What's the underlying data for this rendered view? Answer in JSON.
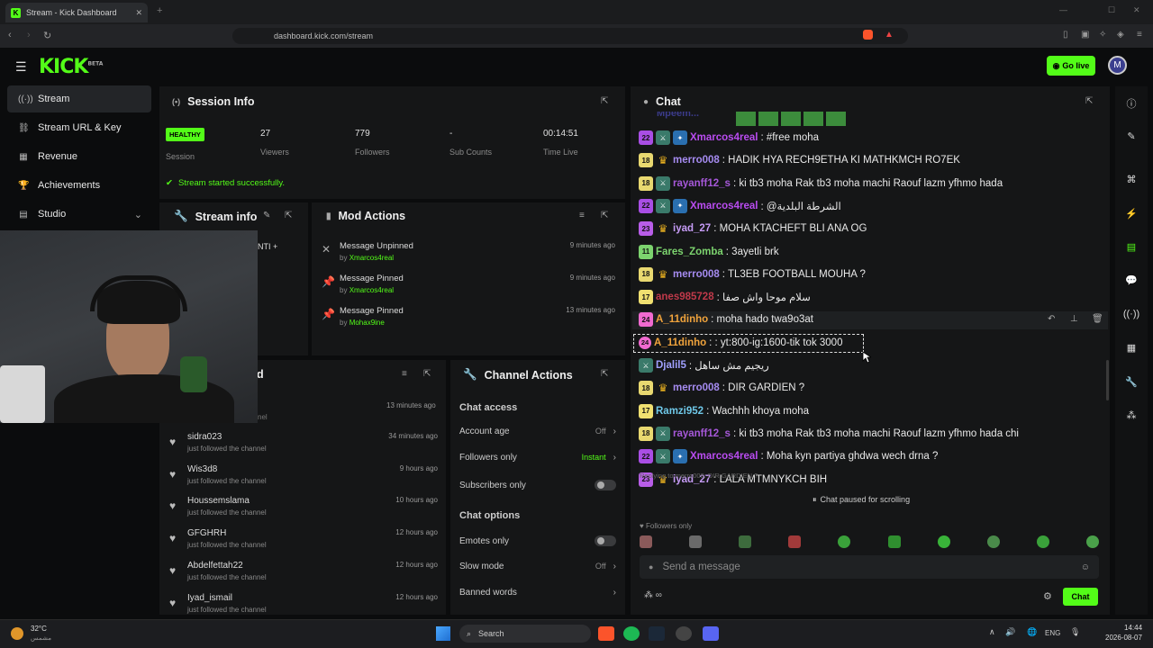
{
  "browser": {
    "tab_title": "Stream - Kick Dashboard",
    "url": "dashboard.kick.com/stream"
  },
  "header": {
    "logo": "KICK",
    "logo_beta": "BETA",
    "go_live": "Go live",
    "avatar": "M"
  },
  "sidebar": {
    "items": [
      {
        "label": "Stream"
      },
      {
        "label": "Stream URL & Key"
      },
      {
        "label": "Revenue"
      },
      {
        "label": "Achievements"
      },
      {
        "label": "Studio"
      }
    ]
  },
  "session": {
    "title": "Session Info",
    "badge": "HEALTHY",
    "badge_label": "Session",
    "stats": [
      {
        "value": "27",
        "label": "Viewers"
      },
      {
        "value": "779",
        "label": "Followers"
      },
      {
        "value": "-",
        "label": "Sub Counts"
      },
      {
        "value": "00:14:51",
        "label": "Time Live"
      }
    ],
    "status": "Stream started successfully."
  },
  "stream_info": {
    "title": "Stream info",
    "partial": "NTI +"
  },
  "mod_actions": {
    "title": "Mod Actions",
    "items": [
      {
        "action": "Message Unpinned",
        "by": "by",
        "user": "Xmarcos4real",
        "time": "9 minutes ago"
      },
      {
        "action": "Message Pinned",
        "by": "by",
        "user": "Xmarcos4real",
        "time": "9 minutes ago"
      },
      {
        "action": "Message Pinned",
        "by": "by",
        "user": "Mohax9ine",
        "time": "13 minutes ago"
      }
    ]
  },
  "activity": {
    "title_tail": "d",
    "first_time": "13 minutes ago",
    "first_sub": "nel",
    "items": [
      {
        "name": "sidra023",
        "desc": "just followed the channel",
        "time": "34 minutes ago"
      },
      {
        "name": "Wis3d8",
        "desc": "just followed the channel",
        "time": "9 hours ago"
      },
      {
        "name": "Houssemslama",
        "desc": "just followed the channel",
        "time": "10 hours ago"
      },
      {
        "name": "GFGHRH",
        "desc": "just followed the channel",
        "time": "12 hours ago"
      },
      {
        "name": "Abdelfettah22",
        "desc": "just followed the channel",
        "time": "12 hours ago"
      },
      {
        "name": "Iyad_ismail",
        "desc": "just followed the channel",
        "time": "12 hours ago"
      }
    ]
  },
  "channel_actions": {
    "title": "Channel Actions",
    "access_heading": "Chat access",
    "account_age": {
      "label": "Account age",
      "value": "Off"
    },
    "followers_only": {
      "label": "Followers only",
      "value": "Instant"
    },
    "subscribers_only": {
      "label": "Subscribers only"
    },
    "options_heading": "Chat options",
    "emotes_only": {
      "label": "Emotes only"
    },
    "slow_mode": {
      "label": "Slow mode",
      "value": "Off"
    },
    "banned_words": {
      "label": "Banned words"
    }
  },
  "chat": {
    "title": "Chat",
    "messages": [
      {
        "lvl": "22",
        "user": "Xmarcos4real",
        "text": ": #free moha"
      },
      {
        "lvl": "18",
        "user": "merro008",
        "text": ": HADIK HYA RECH9ETHA KI MATHKMCH RO7EK"
      },
      {
        "lvl": "18",
        "user": "rayanff12_s",
        "text": ": ki tb3 moha Rak tb3 moha machi Raouf lazm yfhmo hada"
      },
      {
        "lvl": "22",
        "user": "Xmarcos4real",
        "text": ": @الشرطة البلدية"
      },
      {
        "lvl": "23",
        "user": "iyad_27",
        "text": ": MOHA KTACHEFT BLI ANA OG"
      },
      {
        "lvl": "11",
        "user": "Fares_Zomba",
        "text": ": 3ayetli brk"
      },
      {
        "lvl": "18",
        "user": "merro008",
        "text": ": TL3EB FOOTBALL MOUHA ?"
      },
      {
        "lvl": "17",
        "user": "anes985728",
        "text": ": سلام موحا واش صفا"
      },
      {
        "lvl": "24",
        "user": "A_11dinho",
        "text": ": moha hado twa9o3at"
      },
      {
        "lvl": "24",
        "user": "A_11dinho",
        "text": ": : yt:800-ig:1600-tik tok 3000"
      },
      {
        "lvl": "",
        "user": "Djalil5",
        "text": ": ريجيم مش ساهل"
      },
      {
        "lvl": "18",
        "user": "merro008",
        "text": ": DIR GARDIEN ?"
      },
      {
        "lvl": "17",
        "user": "Ramzi952",
        "text": ": Wachhh khoya moha"
      },
      {
        "lvl": "18",
        "user": "rayanff12_s",
        "text": ": ki tb3 moha Rak tb3 moha machi Raouf lazm yfhmo hada chi"
      },
      {
        "lvl": "22",
        "user": "Xmarcos4real",
        "text": ": Moha kyn partiya ghdwa wech drna ?"
      },
      {
        "lvl": "23",
        "user": "iyad_27",
        "text": ": LALA MTMNYKCH BIH"
      }
    ],
    "reply_hint": "Replying to merro008: DIR GARDIEN ?",
    "paused": "Chat paused for scrolling",
    "followers_only": "Followers only",
    "send_placeholder": "Send a message",
    "chat_button": "Chat",
    "top_partial_user": "Mpeem..."
  },
  "taskbar": {
    "weather": "32°C",
    "weather_sub": "مشمس",
    "search": "Search",
    "lang": "ENG",
    "time": "14:44",
    "date": "2026-08-07"
  },
  "colors": {
    "accent": "#53fc18"
  }
}
